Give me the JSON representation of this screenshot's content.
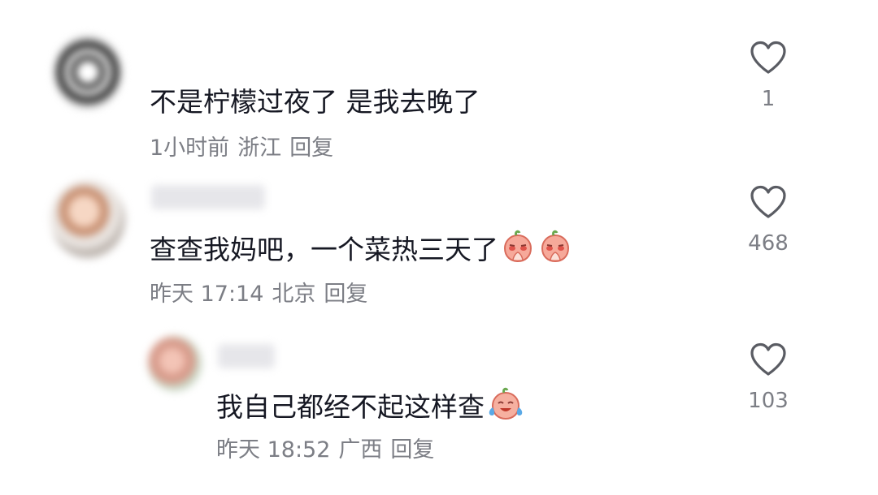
{
  "comments": [
    {
      "text": "不是柠檬过夜了 是我去晚了",
      "time": "1小时前",
      "location": "浙江",
      "reply_label": "回复",
      "likes": "1",
      "emojis": []
    },
    {
      "text": "查查我妈吧，一个菜热三天了",
      "time": "昨天 17:14",
      "location": "北京",
      "reply_label": "回复",
      "likes": "468",
      "emojis": [
        "peach-praying-emoji",
        "peach-praying-emoji"
      ]
    },
    {
      "text": "我自己都经不起这样查",
      "time": "昨天 18:52",
      "location": "广西",
      "reply_label": "回复",
      "likes": "103",
      "emojis": [
        "peach-laugh-cry-emoji"
      ]
    }
  ],
  "icons": {
    "like": "heart-outline-icon"
  },
  "colors": {
    "text": "#161823",
    "meta": "#7c7e85",
    "icon": "#5a5c63"
  }
}
